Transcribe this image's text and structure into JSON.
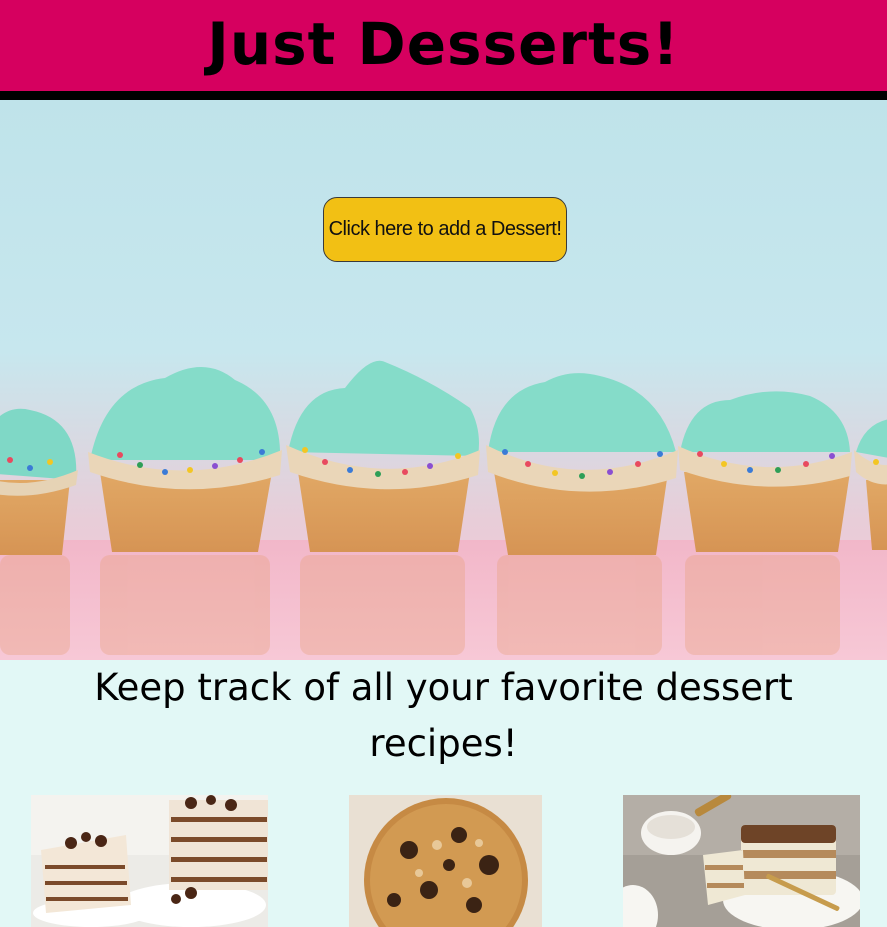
{
  "header": {
    "title": "Just Desserts!"
  },
  "hero": {
    "cta_label": "Click here to add a Dessert!"
  },
  "tagline": "Keep track of all your favorite dessert recipes!",
  "colors": {
    "header_bg": "#d6005f",
    "cta_bg": "#f2c014",
    "page_bg": "#e2f8f6"
  }
}
